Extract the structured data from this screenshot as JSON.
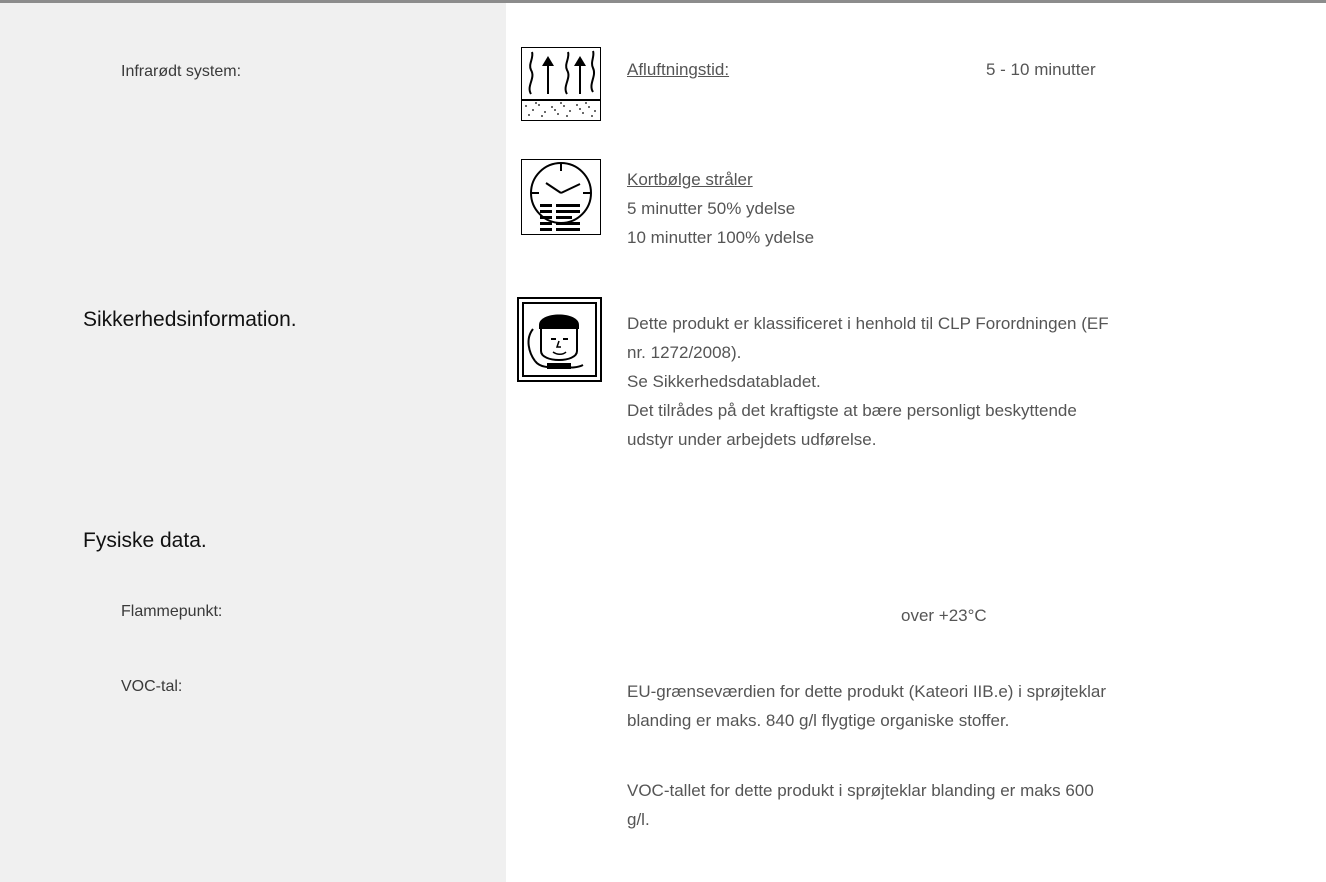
{
  "sections": {
    "infrared": {
      "label": "Infrarødt system:",
      "flash_off": {
        "icon": "flash-off-vapour-icon",
        "title": "Afluftningstid:",
        "value": "5 - 10 minutter"
      },
      "short_wave": {
        "icon": "infrared-clock-icon",
        "title": "Kortbølge stråler",
        "lines": [
          "5 minutter 50% ydelse",
          "10 minutter 100% ydelse"
        ]
      }
    },
    "safety": {
      "heading": "Sikkerhedsinformation.",
      "icon": "protective-mask-icon",
      "lines": [
        "Dette produkt er klassificeret i henhold til CLP Forordningen (EF",
        "nr. 1272/2008).",
        "Se Sikkerhedsdatabladet.",
        "Det tilrådes på det kraftigste at bære personligt beskyttende",
        "udstyr under arbejdets udførelse."
      ]
    },
    "physical": {
      "heading": "Fysiske data.",
      "flashpoint": {
        "label": "Flammepunkt:",
        "value": "over +23°C"
      },
      "voc": {
        "label": "VOC-tal:",
        "paragraph1": [
          "EU-grænseværdien for dette produkt (Kateori IIB.e) i sprøjteklar",
          "blanding er maks. 840 g/l flygtige organiske stoffer."
        ],
        "paragraph2": [
          "VOC-tallet for dette produkt i sprøjteklar blanding er maks 600",
          "g/l."
        ]
      }
    }
  }
}
